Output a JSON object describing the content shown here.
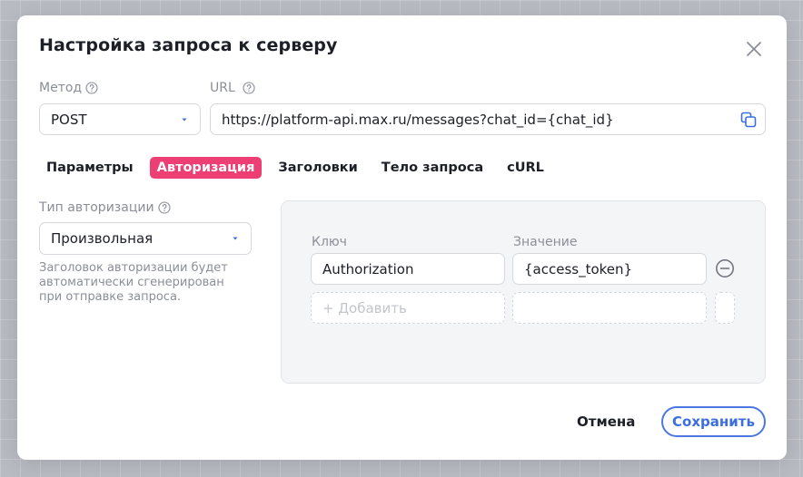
{
  "dialog": {
    "title": "Настройка запроса к серверу"
  },
  "method": {
    "label": "Метод",
    "value": "POST"
  },
  "url": {
    "label": "URL",
    "value": "https://platform-api.max.ru/messages?chat_id={chat_id}"
  },
  "tabs": [
    {
      "label": "Параметры",
      "active": false
    },
    {
      "label": "Авторизация",
      "active": true
    },
    {
      "label": "Заголовки",
      "active": false
    },
    {
      "label": "Тело запроса",
      "active": false
    },
    {
      "label": "cURL",
      "active": false
    }
  ],
  "auth": {
    "type_label": "Тип авторизации",
    "type_value": "Произвольная",
    "hint": "Заголовок авторизации будет автоматически сгенерирован при отправке запроса."
  },
  "headers_table": {
    "key_label": "Ключ",
    "value_label": "Значение",
    "rows": [
      {
        "key": "Authorization",
        "value": "{access_token}"
      }
    ],
    "add_placeholder": "+ Добавить"
  },
  "footer": {
    "cancel_label": "Отмена",
    "save_label": "Сохранить"
  },
  "colors": {
    "accent": "#ee3f74",
    "primary_button": "#3b6ee0",
    "muted_text": "#8b8e98"
  },
  "icons": {
    "close": "close-icon",
    "help": "help-circle-icon",
    "copy": "copy-icon",
    "remove": "minus-circle-icon",
    "dropdown": "caret-down-icon"
  }
}
